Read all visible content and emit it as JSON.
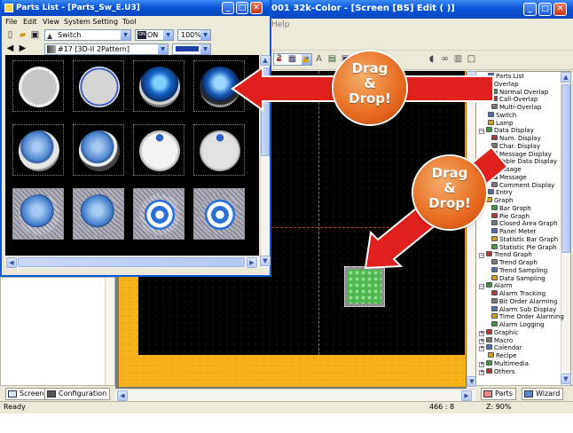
{
  "main_window": {
    "title": "001 32k-Color - [Screen [BS] Edit (                   )]",
    "menu_partial": "Help",
    "zoom_combo_value": "2"
  },
  "parts_window": {
    "title": "Parts List - [Parts_Sw_E.U3]",
    "menu": [
      "File",
      "Edit",
      "View",
      "System Setting",
      "Tool"
    ],
    "type_combo": "Switch",
    "state_combo": "ON",
    "zoom_combo": "100%",
    "pattern_combo": "#17 [3D-II 2Pattern]",
    "color_combo": "",
    "button_styles": [
      "silver-flat",
      "silver-ring",
      "blue-glass",
      "blue-glass-dark",
      "blue-ring",
      "blue-ring-dark",
      "white-dot",
      "white-dot-dim",
      "striped-blue",
      "striped-blue-2",
      "target",
      "target-2"
    ]
  },
  "callouts": {
    "top": {
      "line1": "Drag",
      "line2": "&",
      "line3": "Drop!"
    },
    "bottom": {
      "line1": "Drag",
      "line2": "&",
      "line3": "Drop!"
    }
  },
  "parts_tree": [
    {
      "label": "Parts List",
      "icon": "parts-list-icon",
      "level": 0,
      "expander": ""
    },
    {
      "label": "Overlap",
      "icon": "overlap-icon",
      "level": 0,
      "expander": "−"
    },
    {
      "label": "Normal Overlap",
      "icon": "normal-overlap-icon",
      "level": 1,
      "expander": ""
    },
    {
      "label": "Call-Overlap",
      "icon": "call-overlap-icon",
      "level": 1,
      "expander": ""
    },
    {
      "label": "Multi-Overlap",
      "icon": "multi-overlap-icon",
      "level": 1,
      "expander": ""
    },
    {
      "label": "Switch",
      "icon": "switch-icon",
      "level": 0,
      "expander": ""
    },
    {
      "label": "Lamp",
      "icon": "lamp-icon",
      "level": 0,
      "expander": ""
    },
    {
      "label": "Data Display",
      "icon": "data-display-icon",
      "level": 0,
      "expander": "−"
    },
    {
      "label": "Num. Display",
      "icon": "num-display-icon",
      "level": 1,
      "expander": ""
    },
    {
      "label": "Char. Display",
      "icon": "char-display-icon",
      "level": 1,
      "expander": ""
    },
    {
      "label": "Message Display",
      "icon": "message-display-icon",
      "level": 1,
      "expander": ""
    },
    {
      "label": "Table Data Display",
      "icon": "table-data-display-icon",
      "level": 1,
      "expander": ""
    },
    {
      "label": "Message",
      "icon": "message-icon",
      "level": 0,
      "expander": "−"
    },
    {
      "label": "Message",
      "icon": "message-sub-icon",
      "level": 1,
      "expander": ""
    },
    {
      "label": "Comment Display",
      "icon": "comment-display-icon",
      "level": 1,
      "expander": ""
    },
    {
      "label": "Entry",
      "icon": "entry-icon",
      "level": 0,
      "expander": ""
    },
    {
      "label": "Graph",
      "icon": "graph-icon",
      "level": 0,
      "expander": "−"
    },
    {
      "label": "Bar Graph",
      "icon": "bar-graph-icon",
      "level": 1,
      "expander": ""
    },
    {
      "label": "Pie Graph",
      "icon": "pie-graph-icon",
      "level": 1,
      "expander": ""
    },
    {
      "label": "Closed Area Graph",
      "icon": "closed-area-graph-icon",
      "level": 1,
      "expander": ""
    },
    {
      "label": "Panel Meter",
      "icon": "panel-meter-icon",
      "level": 1,
      "expander": ""
    },
    {
      "label": "Statistic Bar Graph",
      "icon": "statistic-bar-graph-icon",
      "level": 1,
      "expander": ""
    },
    {
      "label": "Statistic Pie Graph",
      "icon": "statistic-pie-graph-icon",
      "level": 1,
      "expander": ""
    },
    {
      "label": "Trend Graph",
      "icon": "trend-graph-icon",
      "level": 0,
      "expander": "−"
    },
    {
      "label": "Trend Graph",
      "icon": "trend-graph-sub-icon",
      "level": 1,
      "expander": ""
    },
    {
      "label": "Trend Sampling",
      "icon": "trend-sampling-icon",
      "level": 1,
      "expander": ""
    },
    {
      "label": "Data Sampling",
      "icon": "data-sampling-icon",
      "level": 1,
      "expander": ""
    },
    {
      "label": "Alarm",
      "icon": "alarm-icon",
      "level": 0,
      "expander": "−"
    },
    {
      "label": "Alarm Tracking",
      "icon": "alarm-tracking-icon",
      "level": 1,
      "expander": ""
    },
    {
      "label": "Bit Order Alarming",
      "icon": "bit-order-alarming-icon",
      "level": 1,
      "expander": ""
    },
    {
      "label": "Alarm Sub Display",
      "icon": "alarm-sub-display-icon",
      "level": 1,
      "expander": ""
    },
    {
      "label": "Time Order Alarming",
      "icon": "time-order-alarming-icon",
      "level": 1,
      "expander": ""
    },
    {
      "label": "Alarm Logging",
      "icon": "alarm-logging-icon",
      "level": 1,
      "expander": ""
    },
    {
      "label": "Graphic",
      "icon": "graphic-icon",
      "level": 0,
      "expander": "+"
    },
    {
      "label": "Macro",
      "icon": "macro-icon",
      "level": 0,
      "expander": "+"
    },
    {
      "label": "Calendar",
      "icon": "calendar-icon",
      "level": 0,
      "expander": "+"
    },
    {
      "label": "Recipe",
      "icon": "recipe-icon",
      "level": 0,
      "expander": ""
    },
    {
      "label": "Multimedia",
      "icon": "multimedia-icon",
      "level": 0,
      "expander": "+"
    },
    {
      "label": "Others",
      "icon": "others-icon",
      "level": 0,
      "expander": "+"
    }
  ],
  "left_tabs": {
    "screen": "Screen",
    "configuration": "Configuration"
  },
  "right_tabs": {
    "parts": "Parts",
    "wizard": "Wizard"
  },
  "status": {
    "left": "Ready",
    "coords": "466 : 8",
    "zoom": "Z: 90%"
  },
  "colors": {
    "arrow_red": "#e0201c",
    "badge_orange": "#e66a1f",
    "title_blue": "#0a55d8",
    "yellow_base": "#f5b21a"
  }
}
